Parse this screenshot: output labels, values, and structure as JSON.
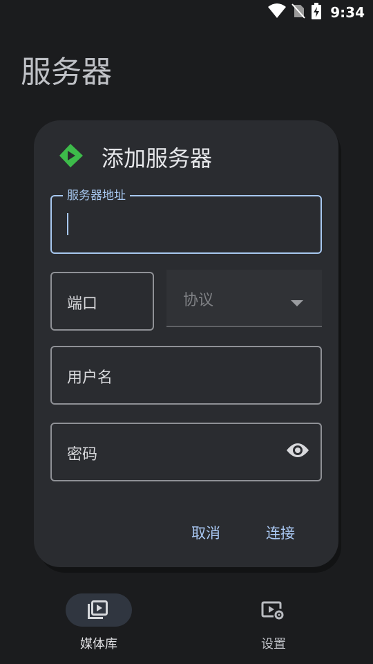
{
  "status_bar": {
    "time": "9:34",
    "icons": [
      "wifi-icon",
      "no-sim-icon",
      "battery-charging-icon"
    ]
  },
  "page": {
    "title": "服务器"
  },
  "dialog": {
    "title": "添加服务器",
    "logo_icon": "app-logo-icon",
    "server_address": {
      "label": "服务器地址",
      "value": ""
    },
    "port": {
      "placeholder": "端口"
    },
    "protocol": {
      "label": "协议",
      "icon": "dropdown-arrow-icon"
    },
    "username": {
      "placeholder": "用户名"
    },
    "password": {
      "placeholder": "密码",
      "toggle_icon": "eye-icon"
    },
    "cancel_label": "取消",
    "connect_label": "连接"
  },
  "bottom_nav": {
    "items": [
      {
        "label": "媒体库",
        "icon": "video-library-icon",
        "active": true
      },
      {
        "label": "设置",
        "icon": "video-settings-icon",
        "active": false
      }
    ]
  },
  "colors": {
    "accent": "#a7c8f0",
    "logo_green": "#3dbb4a",
    "background": "#1b1c1e",
    "dialog": "#2a2c30"
  }
}
